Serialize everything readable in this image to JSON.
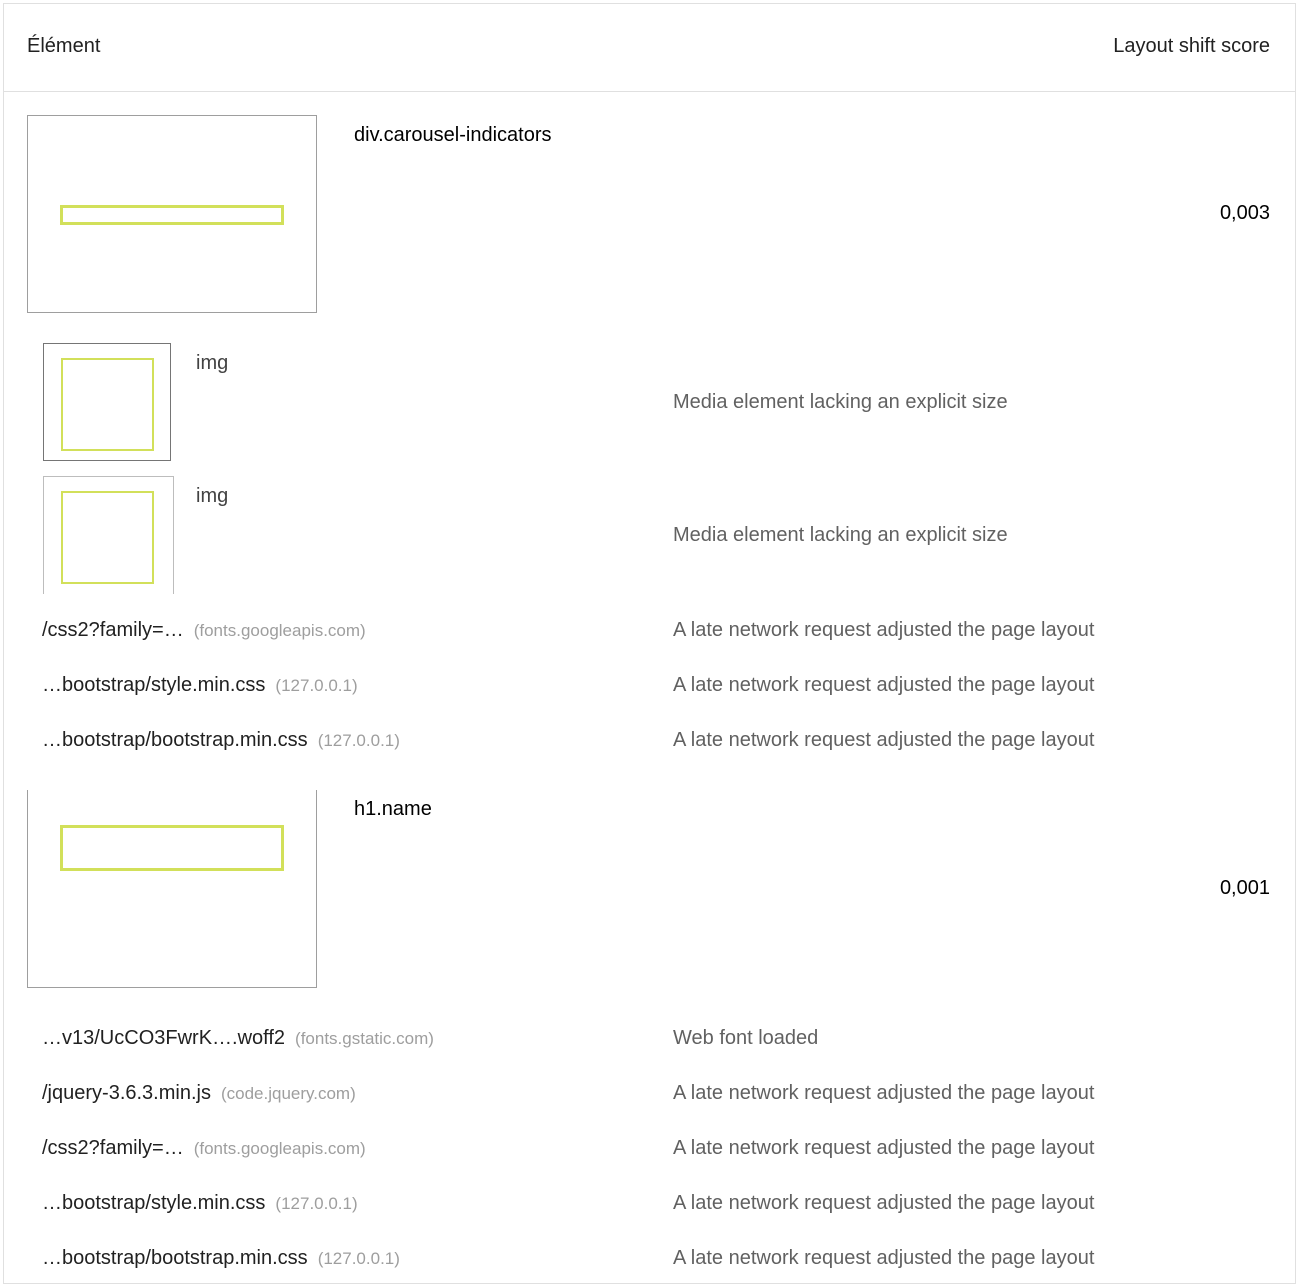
{
  "table": {
    "header": {
      "element": "Élément",
      "score": "Layout shift score"
    },
    "groups": [
      {
        "node": "div.carousel-indicators",
        "score": "0,003",
        "subitems": [
          {
            "label": "img",
            "reason": "Media element lacking an explicit size"
          },
          {
            "label": "img",
            "reason": "Media element lacking an explicit size"
          }
        ],
        "requests": [
          {
            "url": "/css2?family=…",
            "host": "(fonts.googleapis.com)",
            "reason": "A late network request adjusted the page layout"
          },
          {
            "url": "…bootstrap/style.min.css",
            "host": "(127.0.0.1)",
            "reason": "A late network request adjusted the page layout"
          },
          {
            "url": "…bootstrap/bootstrap.min.css",
            "host": "(127.0.0.1)",
            "reason": "A late network request adjusted the page layout"
          }
        ]
      },
      {
        "node": "h1.name",
        "score": "0,001",
        "requests": [
          {
            "url": "…v13/UcCO3FwrK….woff2",
            "host": "(fonts.gstatic.com)",
            "reason": "Web font loaded"
          },
          {
            "url": "/jquery-3.6.3.min.js",
            "host": "(code.jquery.com)",
            "reason": "A late network request adjusted the page layout"
          },
          {
            "url": "/css2?family=…",
            "host": "(fonts.googleapis.com)",
            "reason": "A late network request adjusted the page layout"
          },
          {
            "url": "…bootstrap/style.min.css",
            "host": "(127.0.0.1)",
            "reason": "A late network request adjusted the page layout"
          },
          {
            "url": "…bootstrap/bootstrap.min.css",
            "host": "(127.0.0.1)",
            "reason": "A late network request adjusted the page layout"
          }
        ]
      }
    ]
  },
  "colors": {
    "highlight": "#d2e05a",
    "border": "#e0e0e0",
    "muted_text": "#9e9e9e"
  }
}
